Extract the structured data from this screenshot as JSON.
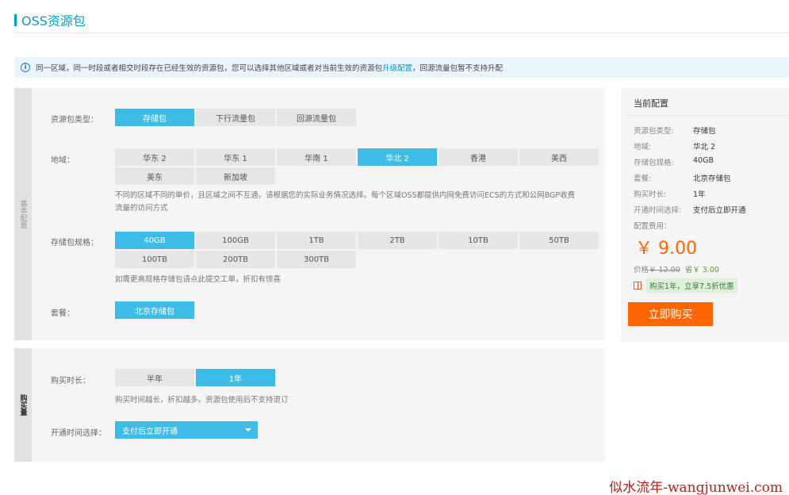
{
  "page": {
    "title": "OSS资源包"
  },
  "notice": {
    "text_before": "同一区域，同一时段或者相交时段存在已经生效的资源包，您可以选择其他区域或者对当前生效的资源包",
    "link": "升级配置",
    "text_after": "，回源流量包暂不支持升配"
  },
  "basic": {
    "tab_label": "基本配置",
    "package_type": {
      "label": "资源包类型：",
      "options": [
        "存储包",
        "下行流量包",
        "回源流量包"
      ],
      "selected": 0
    },
    "region": {
      "label": "地域：",
      "options": [
        "华东 2",
        "华东 1",
        "华南 1",
        "华北 2",
        "香港",
        "美西",
        "美东",
        "新加坡"
      ],
      "selected": 3,
      "hint_line1": "不同的区域不同的单价，且区域之间不互通，请根据您的实际业务情况选择。每个区域OSS都提供内网免费访问ECS的方式和公网BGP收费",
      "hint_line2": "流量的访问方式"
    },
    "spec": {
      "label": "存储包规格：",
      "options": [
        "40GB",
        "100GB",
        "1TB",
        "2TB",
        "10TB",
        "50TB",
        "100TB",
        "200TB",
        "300TB"
      ],
      "selected": 0,
      "hint": "如需更高规格存储包请点此提交工单，折扣有惊喜"
    },
    "plan": {
      "label": "套餐：",
      "options": [
        "北京存储包"
      ],
      "selected": 0
    }
  },
  "buy": {
    "tab_label": "购买量",
    "duration": {
      "label": "购买时长：",
      "options": [
        "半年",
        "1年"
      ],
      "selected": 1,
      "hint": "购买时间越长，折扣越多。资源包使用后不支持退订"
    },
    "activation": {
      "label": "开通时间选择：",
      "value": "支付后立即开通"
    }
  },
  "summary": {
    "title": "当前配置",
    "rows": [
      {
        "k": "资源包类型:",
        "v": "存储包"
      },
      {
        "k": "地域:",
        "v": "华北 2"
      },
      {
        "k": "存储包规格:",
        "v": "40GB"
      },
      {
        "k": "套餐:",
        "v": "北京存储包"
      },
      {
        "k": "购买时长:",
        "v": "1年"
      },
      {
        "k": "开通时间选择:",
        "v": "支付后立即开通"
      }
    ],
    "fee_label": "配置费用：",
    "price": "￥ 9.00",
    "orig_label": "价格",
    "orig_price": "￥ 12.00",
    "save_label": "省",
    "save_amount": "￥ 3.00",
    "promo": "购买1年，立享7.5折优惠",
    "buy_button": "立即购买"
  },
  "watermark": "似水流年-wangjunwei.com",
  "colors": {
    "accent": "#3cbce6",
    "title": "#00a2ca",
    "price": "#ff6600",
    "buy_button": "#ff6600"
  }
}
